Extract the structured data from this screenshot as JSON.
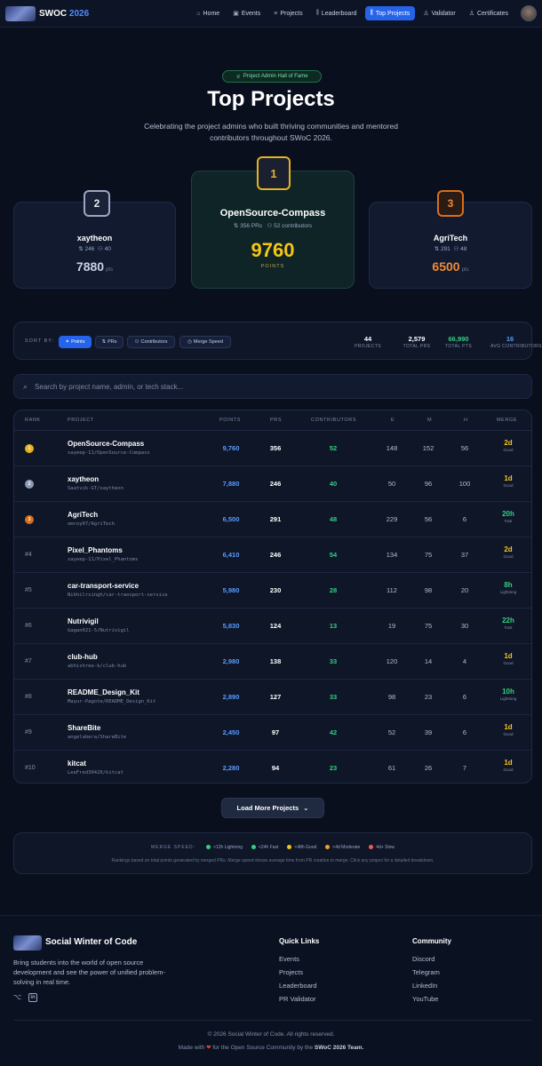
{
  "nav": {
    "brand_prefix": "SWOC",
    "brand_year": "2026",
    "items": [
      {
        "label": "Home",
        "icon": "home-icon",
        "glyph": "⌂",
        "active": false
      },
      {
        "label": "Events",
        "icon": "calendar-icon",
        "glyph": "▣",
        "active": false
      },
      {
        "label": "Projects",
        "icon": "list-icon",
        "glyph": "≡",
        "active": false
      },
      {
        "label": "Leaderboard",
        "icon": "bar-chart-icon",
        "glyph": "⫼",
        "active": false
      },
      {
        "label": "Top Projects",
        "icon": "bar-chart-icon",
        "glyph": "⫼",
        "active": true
      },
      {
        "label": "Validator",
        "icon": "award-icon",
        "glyph": "♙",
        "active": false
      },
      {
        "label": "Certificates",
        "icon": "award-icon",
        "glyph": "♙",
        "active": false
      }
    ]
  },
  "hero": {
    "badge": "Project Admin Hall of Fame",
    "title": "Top Projects",
    "subtitle": "Celebrating the project admins who built thriving communities and mentored contributors throughout SWoC 2026."
  },
  "podium": {
    "first": {
      "rank": "1",
      "name": "OpenSource-Compass",
      "prs": "356 PRs",
      "contributors": "52 contributors",
      "points": "9760",
      "points_label": "POINTS"
    },
    "second": {
      "rank": "2",
      "name": "xaytheon",
      "prs": "246",
      "contributors": "40",
      "points": "7880",
      "unit": "pts"
    },
    "third": {
      "rank": "3",
      "name": "AgriTech",
      "prs": "291",
      "contributors": "48",
      "points": "6500",
      "unit": "pts"
    }
  },
  "sort": {
    "label": "SORT BY:",
    "options": [
      "Points",
      "PRs",
      "Contributors",
      "Merge Speed"
    ],
    "active": "Points"
  },
  "stats": [
    {
      "value": "44",
      "label": "PROJECTS",
      "color": "#ffffff"
    },
    {
      "value": "2,579",
      "label": "TOTAL PRS",
      "color": "#ffffff"
    },
    {
      "value": "66,990",
      "label": "TOTAL PTS",
      "color": "#34d07f"
    },
    {
      "value": "16",
      "label": "AVG CONTRIBUTORS",
      "color": "#5b9bff"
    }
  ],
  "search": {
    "placeholder": "Search by project name, admin, or tech stack..."
  },
  "table": {
    "headers": {
      "rank": "RANK",
      "project": "PROJECT",
      "points": "POINTS",
      "prs": "PRS",
      "contributors": "CONTRIBUTORS",
      "e": "E",
      "m": "M",
      "h": "H",
      "merge": "MERGE"
    },
    "rows": [
      {
        "rank": "1",
        "medal": "#e5b220",
        "name": "OpenSource-Compass",
        "repo": "sayeep-11/OpenSource-Compass",
        "points": "9,760",
        "prs": "356",
        "contributors": "52",
        "e": "148",
        "m": "152",
        "h": "56",
        "merge": "2d",
        "merge_label": "Good",
        "merge_color": "#f5c518"
      },
      {
        "rank": "2",
        "medal": "#8e9bb5",
        "name": "xaytheon",
        "repo": "Saatvik-GT/xaytheon",
        "points": "7,880",
        "prs": "246",
        "contributors": "40",
        "e": "50",
        "m": "96",
        "h": "100",
        "merge": "1d",
        "merge_label": "Good",
        "merge_color": "#f5c518"
      },
      {
        "rank": "3",
        "medal": "#d96f1c",
        "name": "AgriTech",
        "repo": "omroy07/AgriTech",
        "points": "6,500",
        "prs": "291",
        "contributors": "48",
        "e": "229",
        "m": "56",
        "h": "6",
        "merge": "20h",
        "merge_label": "Fast",
        "merge_color": "#34d07f"
      },
      {
        "rank": "#4",
        "medal": "",
        "name": "Pixel_Phantoms",
        "repo": "sayeep-11/Pixel_Phantoms",
        "points": "6,410",
        "prs": "246",
        "contributors": "54",
        "e": "134",
        "m": "75",
        "h": "37",
        "merge": "2d",
        "merge_label": "Good",
        "merge_color": "#f5c518"
      },
      {
        "rank": "#5",
        "medal": "",
        "name": "car-transport-service",
        "repo": "Nikhilrsingh/car-transport-service",
        "points": "5,980",
        "prs": "230",
        "contributors": "28",
        "e": "112",
        "m": "98",
        "h": "20",
        "merge": "8h",
        "merge_label": "Lightning",
        "merge_color": "#34d07f"
      },
      {
        "rank": "#6",
        "medal": "",
        "name": "Nutrivigil",
        "repo": "Gagan021-5/Nutrivigil",
        "points": "5,830",
        "prs": "124",
        "contributors": "13",
        "e": "19",
        "m": "75",
        "h": "30",
        "merge": "22h",
        "merge_label": "Fast",
        "merge_color": "#34d07f"
      },
      {
        "rank": "#7",
        "medal": "",
        "name": "club-hub",
        "repo": "abhishree-k/club-hub",
        "points": "2,980",
        "prs": "138",
        "contributors": "33",
        "e": "120",
        "m": "14",
        "h": "4",
        "merge": "1d",
        "merge_label": "Good",
        "merge_color": "#f5c518"
      },
      {
        "rank": "#8",
        "medal": "",
        "name": "README_Design_Kit",
        "repo": "Mayur-Pagote/README_Design_Kit",
        "points": "2,890",
        "prs": "127",
        "contributors": "33",
        "e": "98",
        "m": "23",
        "h": "6",
        "merge": "10h",
        "merge_label": "Lightning",
        "merge_color": "#34d07f"
      },
      {
        "rank": "#9",
        "medal": "",
        "name": "ShareBite",
        "repo": "angelabera/ShareBite",
        "points": "2,450",
        "prs": "97",
        "contributors": "42",
        "e": "52",
        "m": "39",
        "h": "6",
        "merge": "1d",
        "merge_label": "Good",
        "merge_color": "#f5c518"
      },
      {
        "rank": "#10",
        "medal": "",
        "name": "kitcat",
        "repo": "LeeFred30420/kitcat",
        "points": "2,280",
        "prs": "94",
        "contributors": "23",
        "e": "61",
        "m": "26",
        "h": "7",
        "merge": "1d",
        "merge_label": "Good",
        "merge_color": "#f5c518"
      }
    ]
  },
  "load_more": "Load More Projects",
  "legend": {
    "heading": "MERGE SPEED:",
    "items": [
      {
        "label": "<12h Lightning",
        "color": "#34d07f"
      },
      {
        "label": "<24h Fast",
        "color": "#34d07f"
      },
      {
        "label": "<48h Good",
        "color": "#f5c518"
      },
      {
        "label": "<4d Moderate",
        "color": "#f59e2b"
      },
      {
        "label": "4d+ Slow",
        "color": "#ef5b5b"
      }
    ],
    "note": "Rankings based on total points generated by merged PRs. Merge speed shows average time from PR creation to merge. Click any project for a detailed breakdown."
  },
  "footer": {
    "brand": "Social Winter of Code",
    "description": "Bring students into the world of open source development and see the power of unified problem-solving in real time.",
    "quick_links_title": "Quick Links",
    "quick_links": [
      "Events",
      "Projects",
      "Leaderboard",
      "PR Validator"
    ],
    "community_title": "Community",
    "community": [
      "Discord",
      "Telegram",
      "LinkedIn",
      "YouTube"
    ],
    "copyright": "© 2026 Social Winter of Code. All rights reserved.",
    "made_prefix": "Made with",
    "made_suffix": "for the Open Source Community by the",
    "made_team": "SWoC 2026 Team."
  }
}
